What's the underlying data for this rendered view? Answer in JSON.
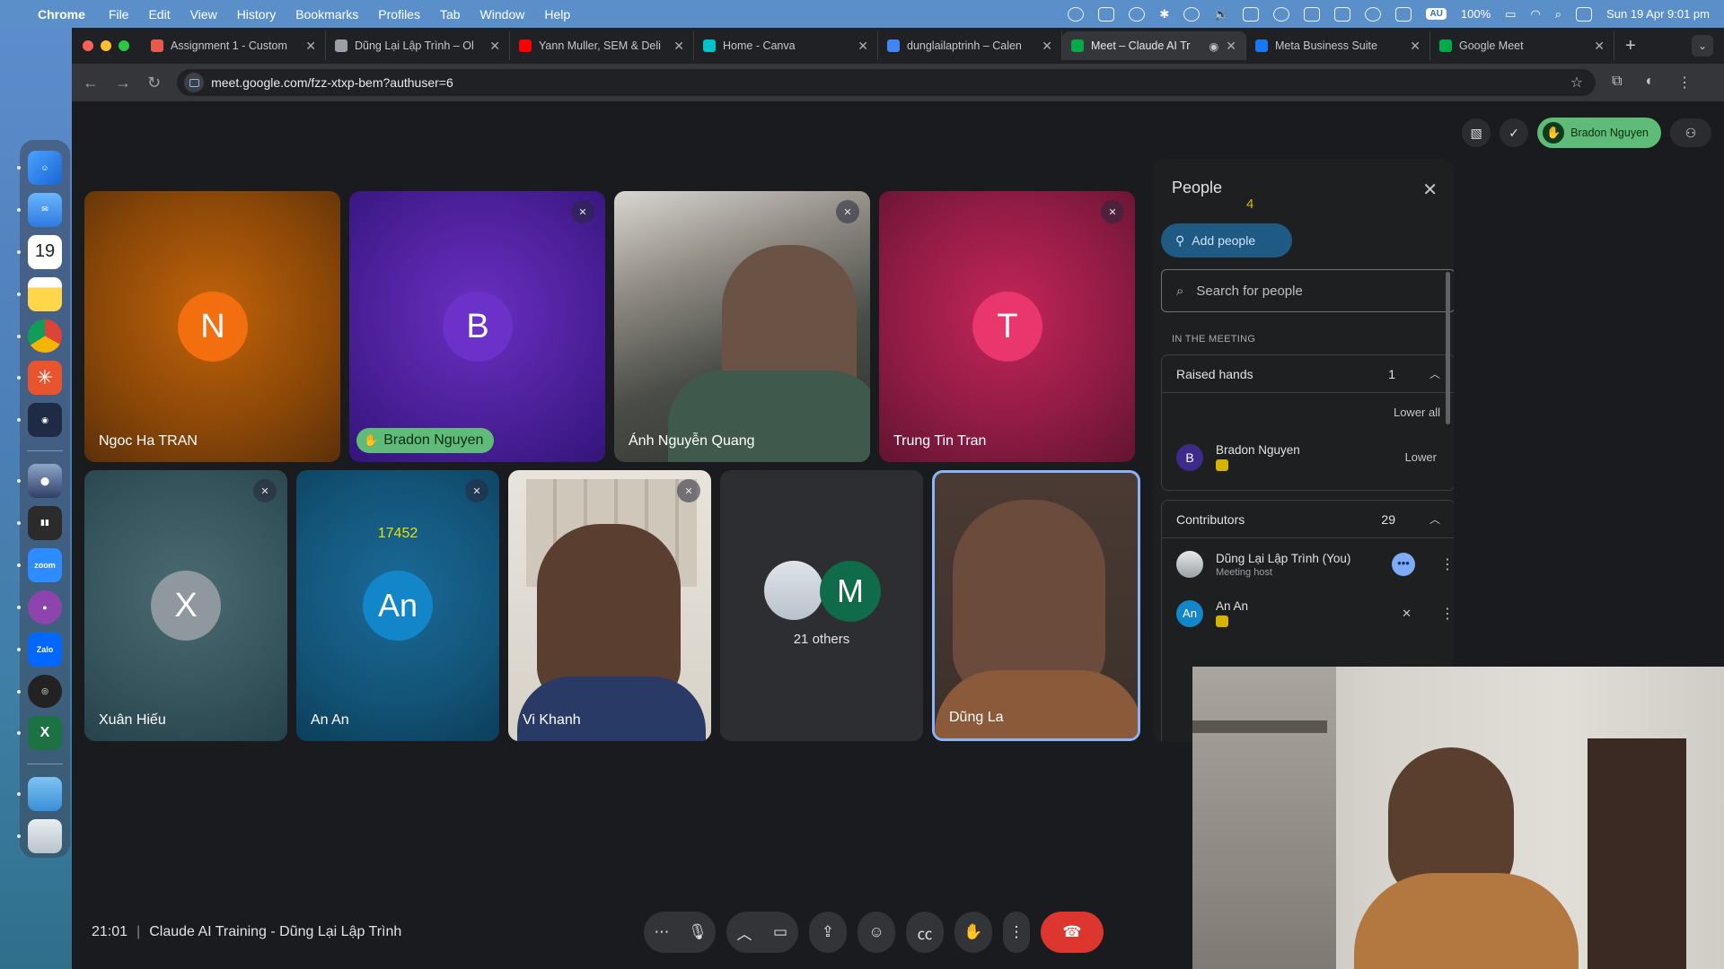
{
  "menubar": {
    "app": "Chrome",
    "items": [
      "File",
      "Edit",
      "View",
      "History",
      "Bookmarks",
      "Profiles",
      "Tab",
      "Window",
      "Help"
    ],
    "battery": "100%",
    "datetime": "Sun 19 Apr  9:01 pm",
    "au_badge": "AU"
  },
  "dock": {
    "calendar_day": "19",
    "zoom_label": "zoom",
    "zalo_label": "Zalo"
  },
  "tabs": [
    {
      "title": "Assignment 1 - Custom",
      "color": "#e85a4f"
    },
    {
      "title": "Dũng Lại Lập Trình – Ol",
      "color": "#9aa0a6"
    },
    {
      "title": "Yann Muller, SEM & Deli",
      "color": "#ff0000"
    },
    {
      "title": "Home - Canva",
      "color": "#00c4cc"
    },
    {
      "title": "dunglailaptrinh – Calen",
      "color": "#4285f4"
    },
    {
      "title": "Meet – Claude AI Tr",
      "color": "#00ac47"
    },
    {
      "title": "Meta Business Suite",
      "color": "#1877f2"
    },
    {
      "title": "Google Meet",
      "color": "#00ac47"
    }
  ],
  "url": "meet.google.com/fzz-xtxp-bem?authuser=6",
  "meet": {
    "raised_chip_name": "Bradon Nguyen",
    "tiles": [
      {
        "name": "Ngoc Ha TRAN",
        "initial": "N"
      },
      {
        "name": "Bradon Nguyen",
        "initial": "B"
      },
      {
        "name": "Ánh Nguyễn Quang"
      },
      {
        "name": "Trung Tin Tran",
        "initial": "T"
      },
      {
        "name": "Xuân Hiếu",
        "initial": "X"
      },
      {
        "name": "An An",
        "initial": "An",
        "overlay_number": "17452"
      },
      {
        "name": "Vi Khanh"
      },
      {
        "name": "21 others",
        "initial": "M"
      },
      {
        "name": "Dũng La"
      }
    ],
    "time": "21:01",
    "meeting_title": "Claude AI Training - Dũng Lại Lập Trình"
  },
  "people": {
    "title": "People",
    "count": "4",
    "add_people": "Add people",
    "search_placeholder": "Search for people",
    "section_label": "IN THE MEETING",
    "raised_hands": {
      "label": "Raised hands",
      "count": "1",
      "lower_all": "Lower all",
      "person": {
        "initial": "B",
        "name": "Bradon Nguyen",
        "action": "Lower"
      }
    },
    "contributors": {
      "label": "Contributors",
      "count": "29",
      "people": [
        {
          "name": "Dũng Lại Lập Trình (You)",
          "sub": "Meeting host"
        },
        {
          "initial": "An",
          "name": "An An"
        }
      ]
    }
  }
}
